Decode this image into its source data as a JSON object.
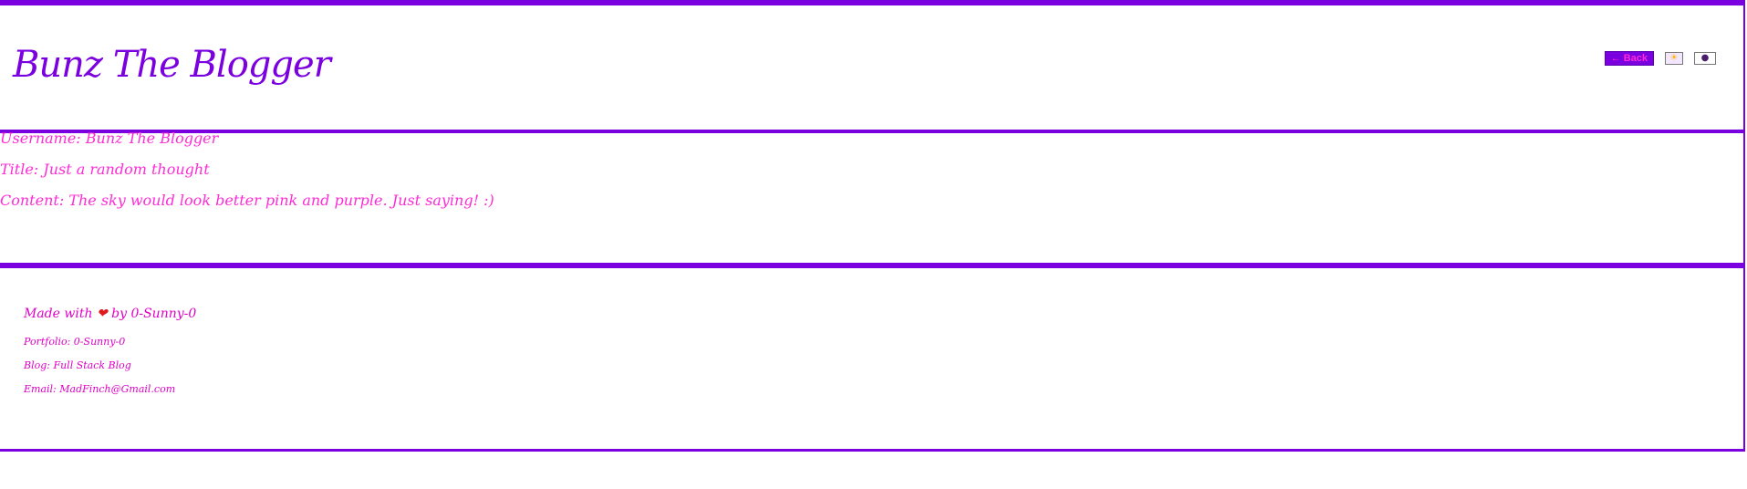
{
  "header": {
    "title": "Bunz The Blogger",
    "back_label": "← Back",
    "sun_glyph": "☀",
    "moon_glyph": "●"
  },
  "post": {
    "username": "Username: Bunz The Blogger",
    "title": "Title: Just a random thought",
    "content": "Content: The sky would look better pink and purple. Just saying! :)"
  },
  "footer": {
    "made_prefix": "Made with",
    "heart": "❤",
    "made_suffix": "by 0-Sunny-0",
    "portfolio": "Portfolio: 0-Sunny-0",
    "blog": "Blog: Full Stack Blog",
    "email": "Email: MadFinch@Gmail.com"
  },
  "colors": {
    "accent_purple": "#7a00e0",
    "text_pink": "#ff2bd6",
    "heart_red": "#e01a1a"
  },
  "icons": [
    "sun-icon",
    "moon-icon",
    "heart-icon"
  ]
}
